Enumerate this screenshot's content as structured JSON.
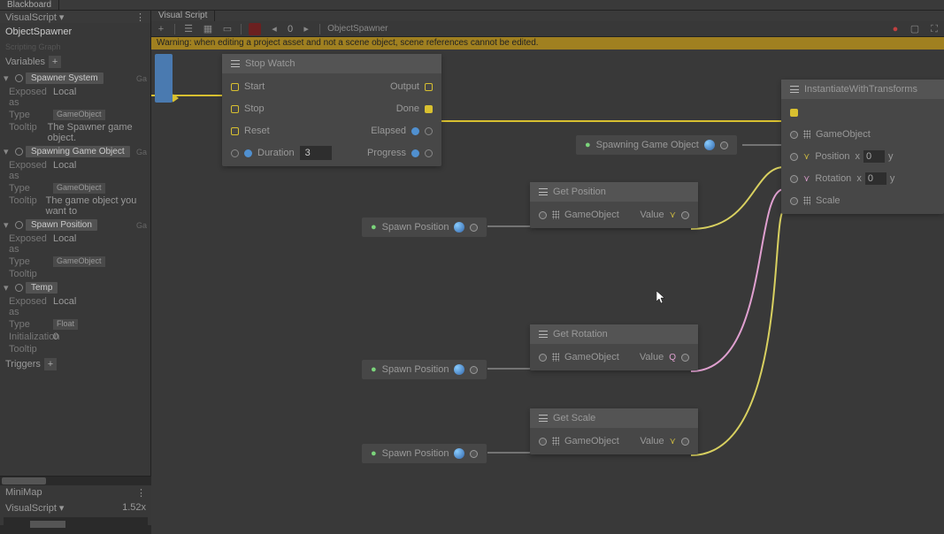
{
  "tabs": {
    "blackboard": "Blackboard",
    "visualScript": "Visual Script"
  },
  "sidebar": {
    "header": "VisualScript ▾",
    "title": "ObjectSpawner",
    "subtitle": "Scripting Graph",
    "variablesLabel": "Variables",
    "triggersLabel": "Triggers",
    "fields": {
      "exposedAs": "Exposed as",
      "type": "Type",
      "tooltip": "Tooltip",
      "initialization": "Initialization",
      "local": "Local",
      "gameObject": "GameObject",
      "float": "Float"
    },
    "vars": [
      {
        "name": "Spawner System",
        "ga": "Ga",
        "tooltip": "The Spawner game object."
      },
      {
        "name": "Spawning Game Object",
        "ga": "Ga",
        "tooltip": "The game object you want to"
      },
      {
        "name": "Spawn Position",
        "ga": "Ga",
        "tooltip": ""
      },
      {
        "name": "Temp",
        "ga": "",
        "tooltip": "",
        "init": "0",
        "isFloat": true
      }
    ]
  },
  "toolbar": {
    "counter": "0",
    "crumb": "ObjectSpawner"
  },
  "warning": "Warning: when editing a project asset and not a scene object, scene references cannot be edited.",
  "nodes": {
    "stopwatch": {
      "title": "Stop Watch",
      "inputs": [
        "Start",
        "Stop",
        "Reset"
      ],
      "durationLabel": "Duration",
      "durationVal": "3",
      "outputs": [
        "Output",
        "Done",
        "Elapsed",
        "Progress"
      ]
    },
    "getPos": {
      "title": "Get Position",
      "in": "GameObject",
      "out": "Value"
    },
    "getRot": {
      "title": "Get Rotation",
      "in": "GameObject",
      "out": "Value"
    },
    "getScale": {
      "title": "Get Scale",
      "in": "GameObject",
      "out": "Value"
    },
    "inst": {
      "title": "InstantiateWithTransforms",
      "rows": [
        "GameObject",
        "Position",
        "Rotation",
        "Scale"
      ],
      "x": "x",
      "zero": "0",
      "y": "y"
    },
    "spawnPos": "Spawn Position",
    "spawnGO": "Spawning Game Object"
  },
  "minimap": {
    "label": "MiniMap",
    "vs": "VisualScript ▾",
    "zoom": "1.52x"
  }
}
